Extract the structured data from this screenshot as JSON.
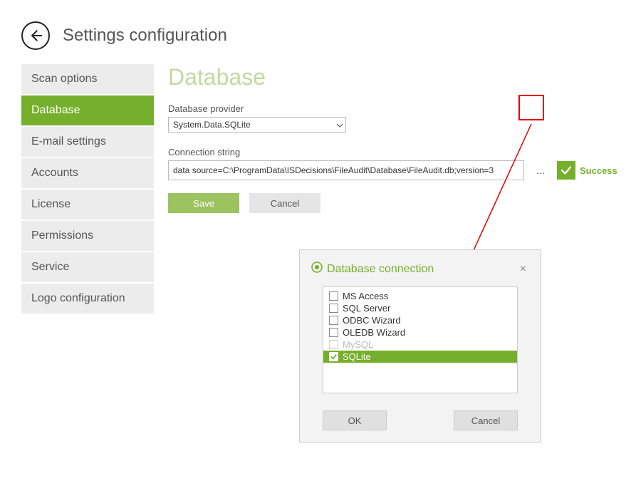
{
  "header": {
    "title": "Settings configuration"
  },
  "sidebar": {
    "items": [
      {
        "label": "Scan options",
        "active": false
      },
      {
        "label": "Database",
        "active": true
      },
      {
        "label": "E-mail settings",
        "active": false
      },
      {
        "label": "Accounts",
        "active": false
      },
      {
        "label": "License",
        "active": false
      },
      {
        "label": "Permissions",
        "active": false
      },
      {
        "label": "Service",
        "active": false
      },
      {
        "label": "Logo configuration",
        "active": false
      }
    ]
  },
  "main": {
    "title": "Database",
    "provider_label": "Database provider",
    "provider_value": "System.Data.SQLite",
    "connstr_label": "Connection string",
    "connstr_value": "data source=C:\\ProgramData\\ISDecisions\\FileAudit\\Database\\FileAudit.db;version=3",
    "ellipsis": "...",
    "success_label": "Success",
    "save_label": "Save",
    "cancel_label": "Cancel"
  },
  "popup": {
    "title": "Database connection",
    "options": [
      {
        "label": "MS Access",
        "checked": false,
        "disabled": false,
        "selected": false
      },
      {
        "label": "SQL Server",
        "checked": false,
        "disabled": false,
        "selected": false
      },
      {
        "label": "ODBC Wizard",
        "checked": false,
        "disabled": false,
        "selected": false
      },
      {
        "label": "OLEDB Wizard",
        "checked": false,
        "disabled": false,
        "selected": false
      },
      {
        "label": "MySQL",
        "checked": false,
        "disabled": true,
        "selected": false
      },
      {
        "label": "SQLite",
        "checked": true,
        "disabled": false,
        "selected": true
      }
    ],
    "ok_label": "OK",
    "cancel_label": "Cancel"
  },
  "colors": {
    "accent": "#76af2c",
    "annotation": "#e30000"
  }
}
